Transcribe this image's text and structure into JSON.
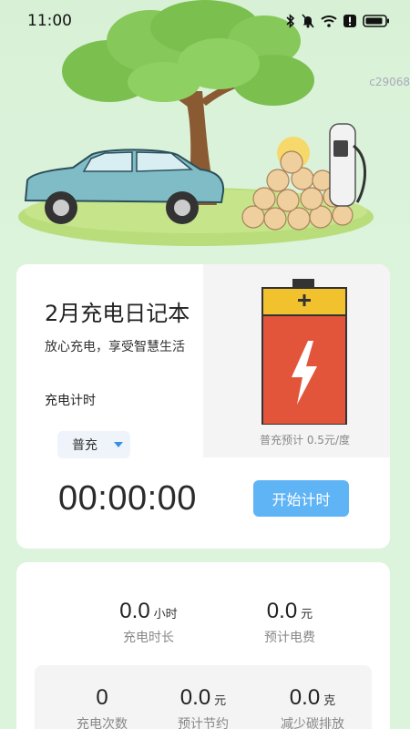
{
  "status_bar": {
    "time": "11:00"
  },
  "watermark": "c29068",
  "diary": {
    "title": "2月充电日记本",
    "subtitle": "放心充电，享受智慧生活",
    "timer_label": "充电计时",
    "price_note": "普充预计 0.5元/度",
    "mode_value": "普充",
    "timer_value": "00:00:00",
    "start_button": "开始计时"
  },
  "stats": {
    "duration": {
      "value": "0.0",
      "unit": "小时",
      "label": "充电时长"
    },
    "cost": {
      "value": "0.0",
      "unit": "元",
      "label": "预计电费"
    },
    "count": {
      "value": "0",
      "unit": "",
      "label": "充电次数"
    },
    "saving": {
      "value": "0.0",
      "unit": "元",
      "label": "预计节约"
    },
    "carbon": {
      "value": "0.0",
      "unit": "克",
      "label": "减少碳排放"
    }
  },
  "colors": {
    "background": "#dcf3dc",
    "accent_button": "#5fb4f6",
    "battery_red": "#e2553a",
    "battery_yellow": "#f2c12e"
  }
}
